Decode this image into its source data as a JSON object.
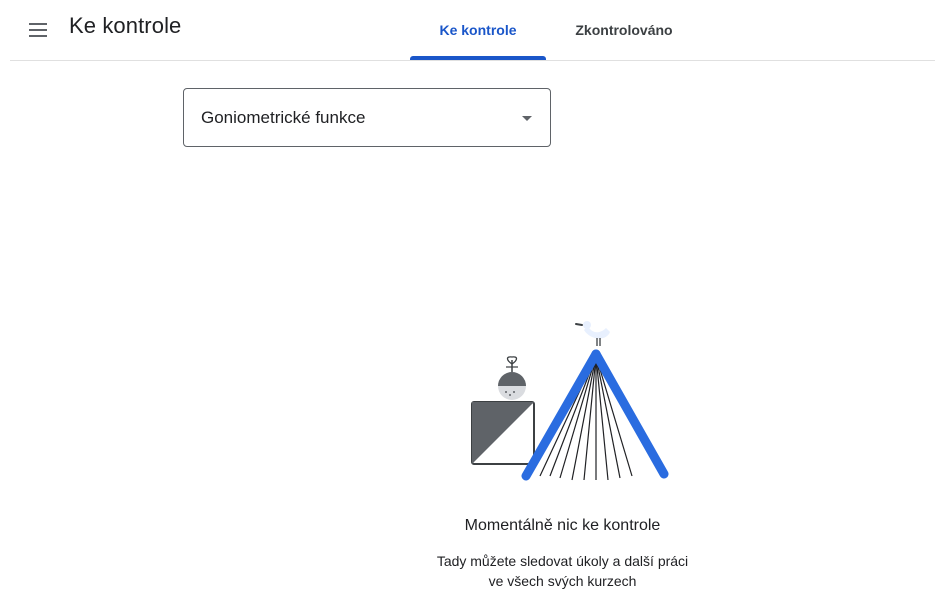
{
  "header": {
    "title": "Ke kontrole",
    "menu_icon": "hamburger-menu-icon"
  },
  "tabs": [
    {
      "label": "Ke kontrole",
      "active": true
    },
    {
      "label": "Zkontrolováno",
      "active": false
    }
  ],
  "course_filter": {
    "selected": "Goniometrické funkce",
    "icon": "dropdown-arrow-icon"
  },
  "empty_state": {
    "illustration": "empty-state-illustration",
    "title": "Momentálně nic ke kontrole",
    "description_line1": "Tady můžete sledovat úkoly a další práci",
    "description_line2": "ve všech svých kurzech"
  },
  "colors": {
    "accent": "#1a56c9",
    "text": "#202124",
    "divider": "#e0e0e0"
  }
}
